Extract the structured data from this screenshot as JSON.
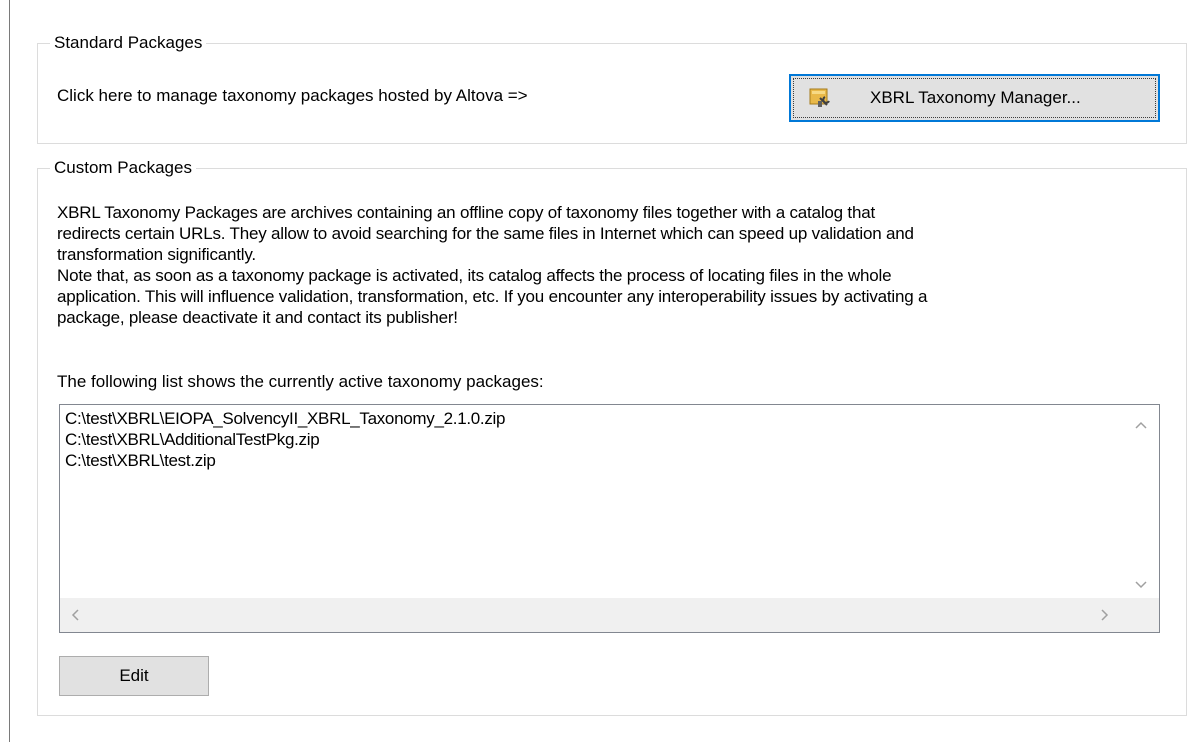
{
  "standard_packages": {
    "title": "Standard Packages",
    "prompt": "Click here to manage taxonomy packages hosted by Altova =>",
    "manager_button_label": "XBRL Taxonomy Manager..."
  },
  "custom_packages": {
    "title": "Custom Packages",
    "description_lines": [
      "XBRL Taxonomy Packages are archives containing an offline copy of taxonomy files together with a catalog that",
      "redirects certain URLs. They allow to avoid searching for the same files in Internet which can speed up validation and",
      "transformation significantly.",
      "Note that, as soon as a taxonomy package is activated, its catalog affects the process of locating files in the whole",
      "application. This will influence validation, transformation, etc. If you encounter any interoperability issues by activating a",
      "package, please deactivate it and contact its publisher!"
    ],
    "list_heading": "The following list shows the currently active taxonomy packages:",
    "packages": [
      "C:\\test\\XBRL\\EIOPA_SolvencyII_XBRL_Taxonomy_2.1.0.zip",
      "C:\\test\\XBRL\\AdditionalTestPkg.zip",
      "C:\\test\\XBRL\\test.zip"
    ],
    "edit_button_label": "Edit"
  },
  "icons": {
    "manager_icon": "package-tool-icon",
    "scroll_up": "chevron-up-icon",
    "scroll_down": "chevron-down-icon",
    "scroll_left": "chevron-left-icon",
    "scroll_right": "chevron-right-icon"
  },
  "colors": {
    "focus_border": "#0078d7",
    "button_face": "#e1e1e1",
    "groupbox_border": "#dcdcdc"
  }
}
